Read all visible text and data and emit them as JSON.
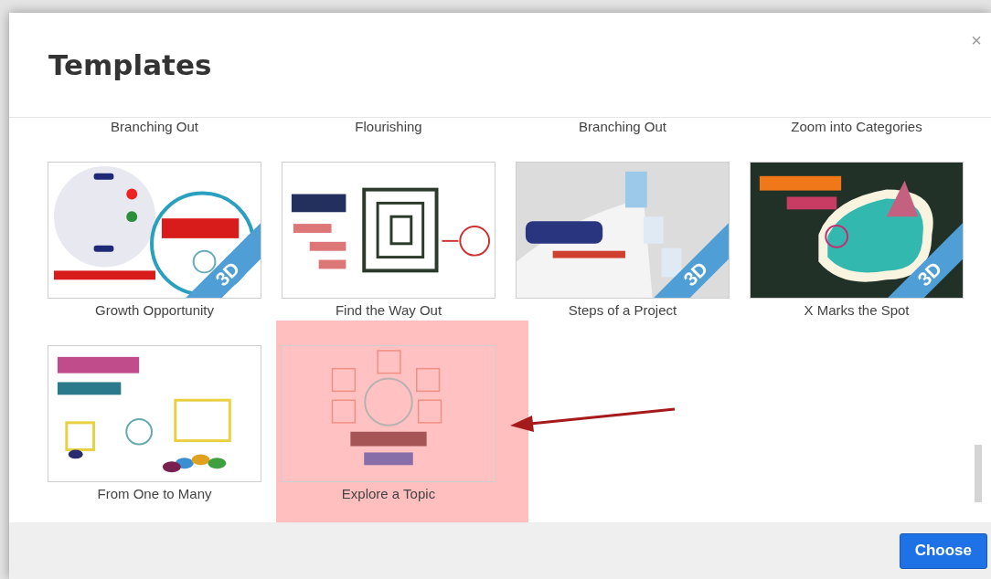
{
  "dialog": {
    "title": "Templates",
    "close": "×"
  },
  "templates": [
    {
      "name": "Branching Out",
      "thumbnail_hidden": true,
      "selected": false
    },
    {
      "name": "Flourishing",
      "thumbnail_hidden": true,
      "selected": false
    },
    {
      "name": "Branching Out",
      "thumbnail_hidden": true,
      "selected": false
    },
    {
      "name": "Zoom into Categories",
      "thumbnail_hidden": true,
      "selected": false
    },
    {
      "name": "Growth Opportunity",
      "badge": "3D",
      "selected": false
    },
    {
      "name": "Find the Way Out",
      "selected": false
    },
    {
      "name": "Steps of a Project",
      "badge": "3D",
      "selected": false
    },
    {
      "name": "X Marks the Spot",
      "badge": "3D",
      "selected": false
    },
    {
      "name": "From One to Many",
      "selected": false
    },
    {
      "name": "Explore a Topic",
      "selected": true
    }
  ],
  "footer": {
    "button": "Choose"
  }
}
